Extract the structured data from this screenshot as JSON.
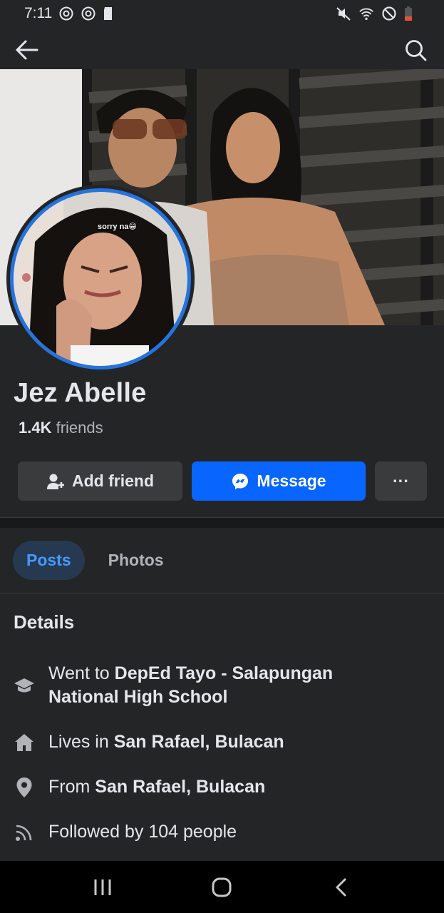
{
  "status_bar": {
    "time": "7:11",
    "icons": [
      "sync-icon",
      "sync-icon",
      "sd-card-icon",
      "mute-icon",
      "wifi-icon",
      "dnd-icon",
      "battery-low-icon"
    ],
    "battery_color": "#e0533b"
  },
  "app_bar": {
    "back_icon": "arrow-left-icon",
    "search_icon": "search-icon"
  },
  "profile": {
    "avatar_caption": "sorry na😁",
    "name": "Jez Abelle",
    "friends_count": "1.4K",
    "friends_label": "friends",
    "ring_color": "#2374e1"
  },
  "actions": {
    "add_friend_label": "Add friend",
    "message_label": "Message",
    "more_label": "···",
    "message_color": "#0866ff"
  },
  "tabs": [
    {
      "label": "Posts",
      "active": true
    },
    {
      "label": "Photos",
      "active": false
    }
  ],
  "details": {
    "title": "Details",
    "education": {
      "prefix": "Went to ",
      "value": "DepEd Tayo - Salapungan National High School",
      "icon": "graduation-cap-icon"
    },
    "lives_in": {
      "prefix": "Lives in ",
      "value": "San Rafael, Bulacan",
      "icon": "home-icon"
    },
    "from": {
      "prefix": "From ",
      "value": "San Rafael, Bulacan",
      "icon": "location-pin-icon"
    },
    "followers": {
      "text": "Followed by 104 people",
      "icon": "rss-icon"
    }
  },
  "nav_bar": {
    "recents_icon": "recents-icon",
    "home_icon": "home-button-icon",
    "back_icon": "back-chevron-icon"
  }
}
